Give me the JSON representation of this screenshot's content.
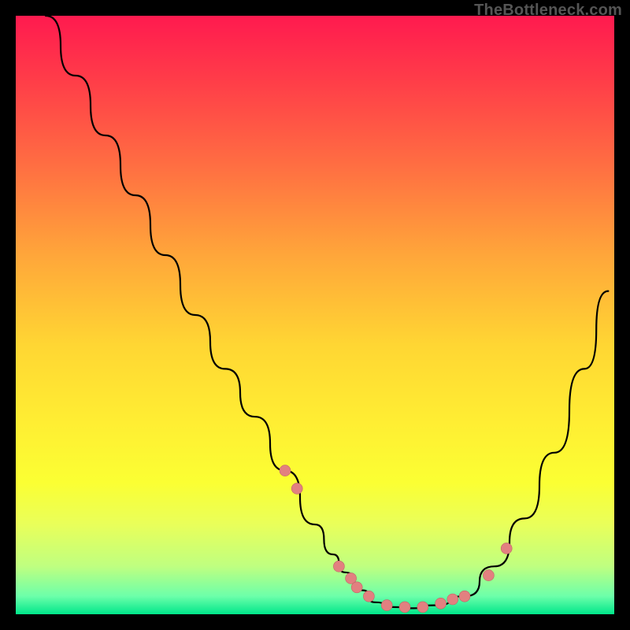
{
  "watermark": "TheBottleneck.com",
  "colors": {
    "page_bg": "#000000",
    "gradient_top": "#ff1a4f",
    "gradient_bottom": "#00e68a",
    "curve": "#000000",
    "dot_fill": "#e28080",
    "dot_stroke": "#c06565"
  },
  "chart_data": {
    "type": "line",
    "title": "",
    "xlabel": "",
    "ylabel": "",
    "xlim": [
      0,
      100
    ],
    "ylim": [
      0,
      100
    ],
    "grid": false,
    "series": [
      {
        "name": "curve",
        "x": [
          5,
          10,
          15,
          20,
          25,
          30,
          35,
          40,
          45,
          50,
          53,
          55,
          58,
          60,
          63,
          66,
          70,
          75,
          80,
          85,
          90,
          95,
          99
        ],
        "values": [
          100,
          90,
          80,
          70,
          60,
          50,
          41,
          33,
          24,
          15,
          10,
          7,
          4,
          2,
          1.2,
          1,
          1.5,
          3,
          8,
          16,
          27,
          41,
          54
        ]
      }
    ],
    "markers": {
      "name": "dots",
      "x": [
        45,
        47,
        54,
        56,
        57,
        59,
        62,
        65,
        68,
        71,
        73,
        75,
        79,
        82
      ],
      "values": [
        24,
        21,
        8,
        6,
        4.5,
        3,
        1.5,
        1.2,
        1.2,
        1.8,
        2.5,
        3,
        6.5,
        11
      ]
    }
  }
}
